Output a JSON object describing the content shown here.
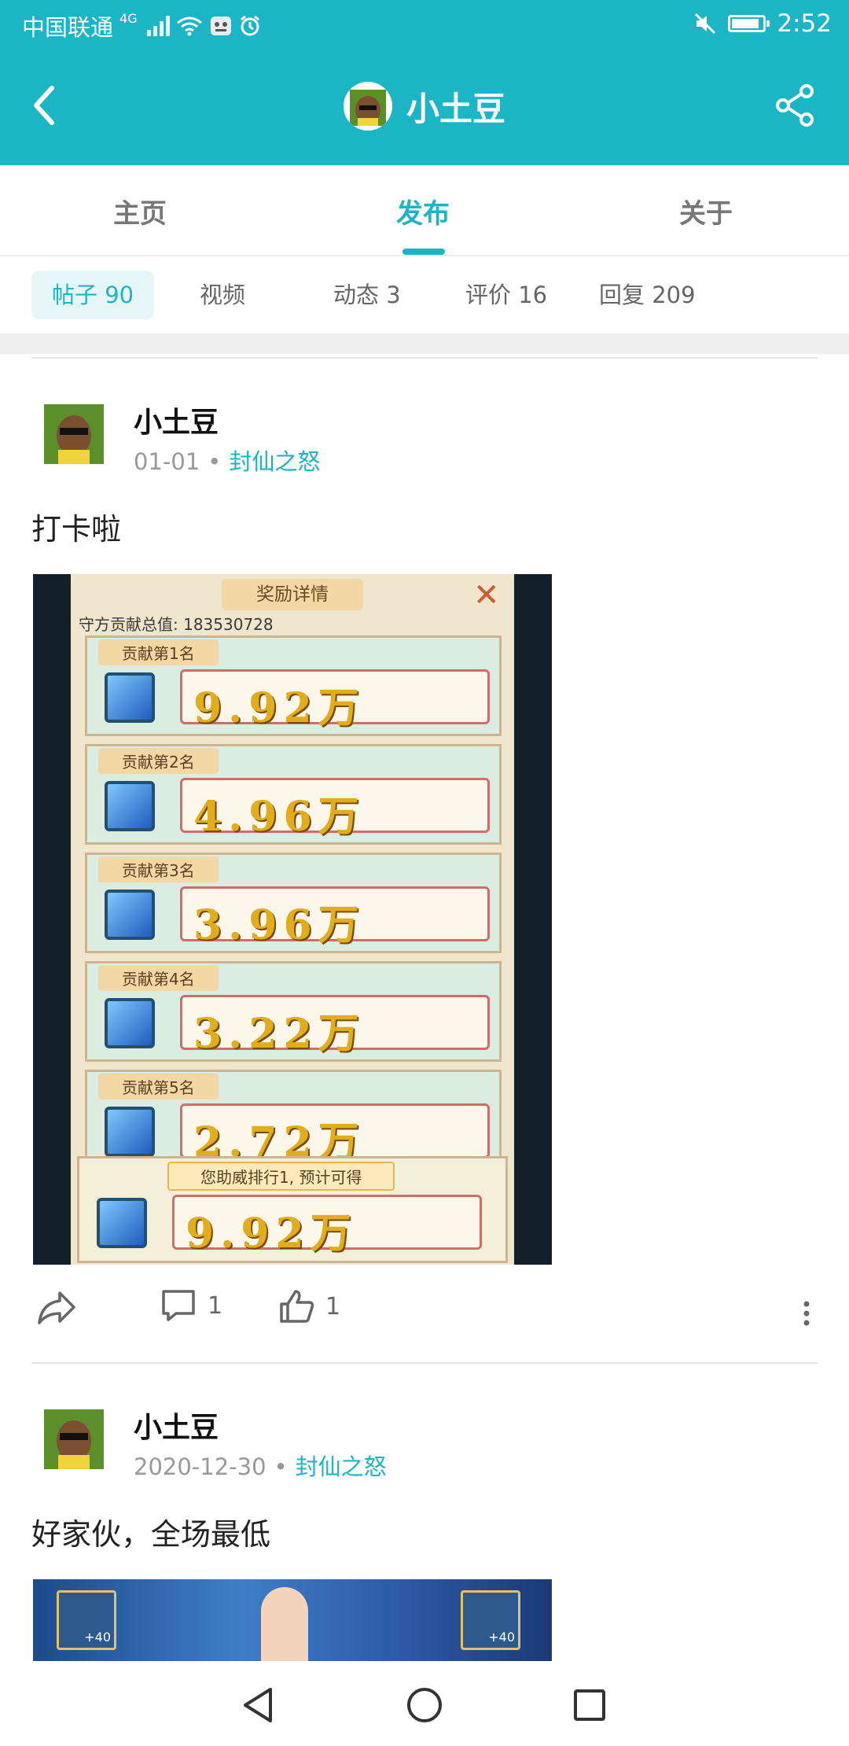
{
  "status_bar": {
    "carrier": "中国联通",
    "network": "4G",
    "time": "2:52"
  },
  "header": {
    "title": "小土豆",
    "back_icon": "back-arrow-icon",
    "share_icon": "share-icon"
  },
  "tabs": [
    {
      "label": "主页",
      "active": false
    },
    {
      "label": "发布",
      "active": true
    },
    {
      "label": "关于",
      "active": false
    }
  ],
  "subtabs": [
    {
      "label": "帖子 90",
      "active": true
    },
    {
      "label": "视频",
      "active": false
    },
    {
      "label": "动态 3",
      "active": false
    },
    {
      "label": "评价 16",
      "active": false
    },
    {
      "label": "回复 209",
      "active": false
    }
  ],
  "posts": [
    {
      "author": "小土豆",
      "date": "01-01",
      "game": "封仙之怒",
      "text": "打卡啦",
      "image": {
        "title": "奖励详情",
        "total_label": "守方贡献总值: 183530728",
        "rows": [
          {
            "rank": "贡献第1名",
            "value": "9.92万"
          },
          {
            "rank": "贡献第2名",
            "value": "4.96万"
          },
          {
            "rank": "贡献第3名",
            "value": "3.96万"
          },
          {
            "rank": "贡献第4名",
            "value": "3.22万"
          },
          {
            "rank": "贡献第5名",
            "value": "2.72万"
          }
        ],
        "footer_note": "您助威排行1, 预计可得",
        "footer_value": "9.92万"
      },
      "comments": "1",
      "likes": "1"
    },
    {
      "author": "小土豆",
      "date": "2020-12-30",
      "game": "封仙之怒",
      "text": "好家伙，全场最低",
      "image": {
        "badge_left": "+40",
        "badge_right": "+40"
      }
    }
  ],
  "colors": {
    "accent": "#1bb5c6",
    "chip_bg": "#e6f6f8",
    "text_muted": "#999999"
  }
}
